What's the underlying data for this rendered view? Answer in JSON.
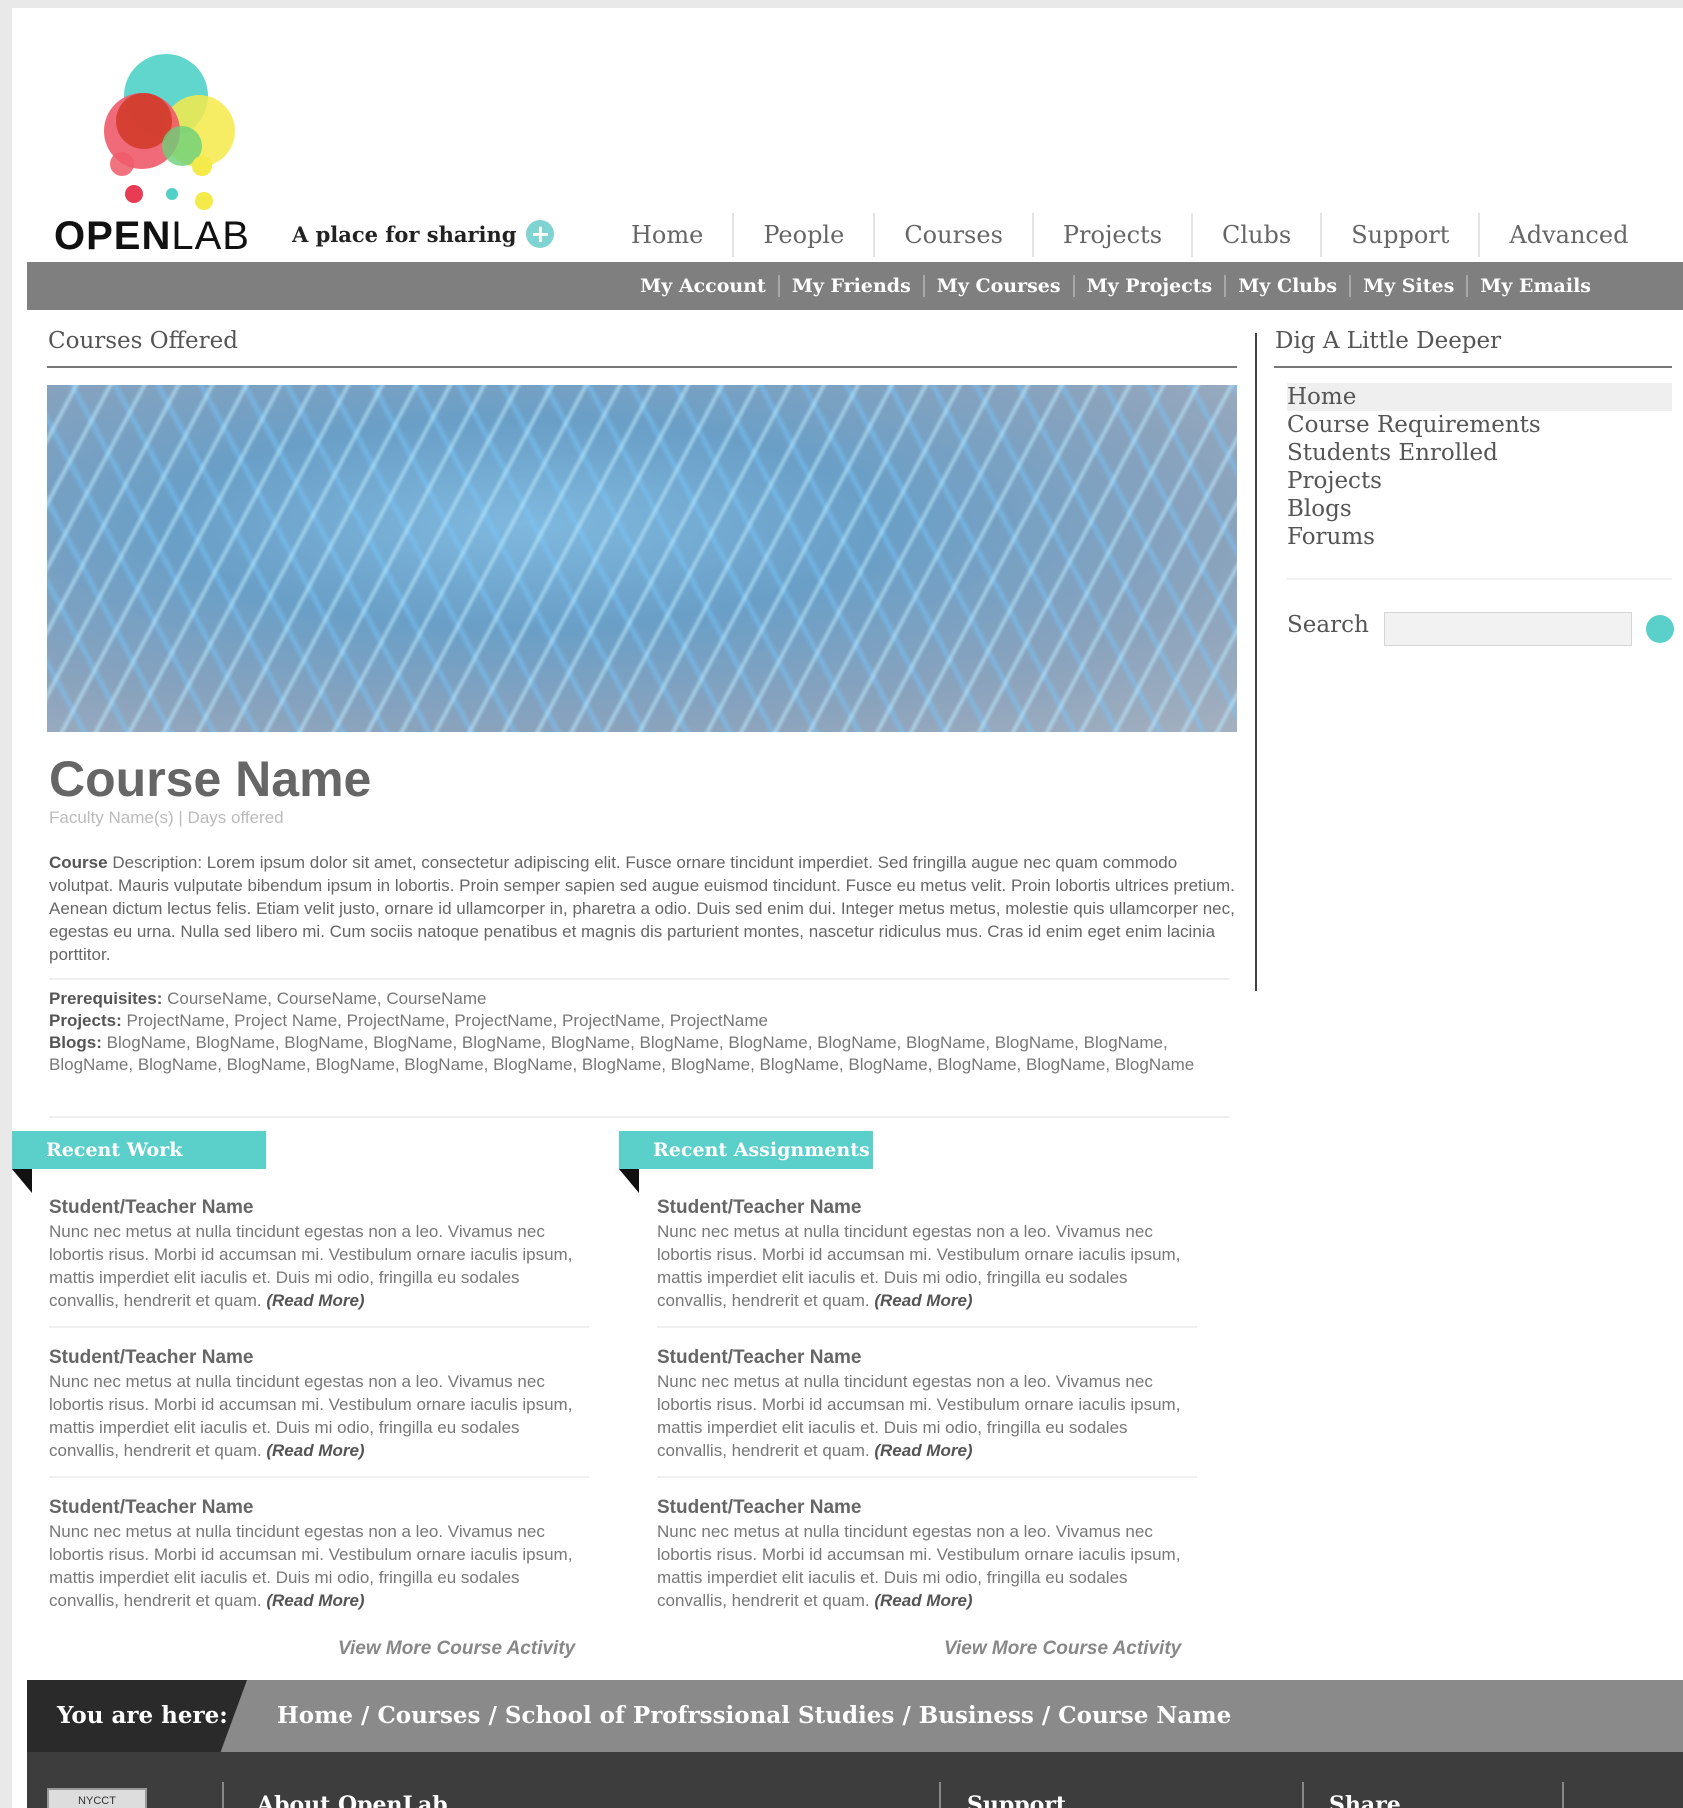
{
  "brand": {
    "logo_name": "OPENLAB",
    "logo_bold": "OPEN",
    "logo_light": "LAB",
    "tagline": "A place for sharing",
    "accent": "#5bd0ca"
  },
  "main_nav": [
    "Home",
    "People",
    "Courses",
    "Projects",
    "Clubs",
    "Support",
    "Advanced Search"
  ],
  "sub_nav": [
    "My Account",
    "My Friends",
    "My Courses",
    "My Projects",
    "My Clubs",
    "My Sites",
    "My Emails"
  ],
  "content": {
    "section_title": "Courses Offered",
    "course_name": "Course Name",
    "faculty_line": "Faculty Name(s) | Days offered",
    "description_label": "Course",
    "description": "Description: Lorem ipsum dolor sit amet, consectetur adipiscing elit. Fusce ornare tincidunt imperdiet. Sed fringilla augue nec quam commodo volutpat. Mauris vulputate bibendum ipsum in lobortis. Proin semper sapien sed augue euismod tincidunt. Fusce eu metus velit. Proin lobortis ultrices pretium. Aenean dictum lectus felis. Etiam velit justo, ornare id ullamcorper in, pharetra a odio. Duis sed enim dui. Integer metus metus, molestie quis ullamcorper nec, egestas eu urna. Nulla sed libero mi. Cum sociis natoque penatibus et magnis dis parturient montes, nascetur ridiculus mus. Cras id enim eget enim lacinia porttitor.",
    "prerequisites_label": "Prerequisites:",
    "prerequisites": "CourseName, CourseName, CourseName",
    "projects_label": "Projects:",
    "projects": "ProjectName, Project Name, ProjectName, ProjectName, ProjectName, ProjectName",
    "blogs_label": "Blogs:",
    "blogs": "BlogName, BlogName, BlogName, BlogName, BlogName, BlogName, BlogName, BlogName, BlogName, BlogName, BlogName, BlogName, BlogName, BlogName, BlogName, BlogName, BlogName, BlogName, BlogName, BlogName, BlogName, BlogName, BlogName, BlogName, BlogName"
  },
  "recent_work": {
    "title": "Recent Work",
    "entries": [
      {
        "name": "Student/Teacher Name",
        "text": "Nunc nec metus at nulla tincidunt egestas non a leo. Vivamus nec lobortis risus. Morbi id accumsan mi. Vestibulum ornare iaculis ipsum, mattis imperdiet elit iaculis et. Duis mi odio, fringilla eu sodales convallis, hendrerit et quam.",
        "read_more": "(Read More)"
      },
      {
        "name": "Student/Teacher Name",
        "text": "Nunc nec metus at nulla tincidunt egestas non a leo. Vivamus nec lobortis risus. Morbi id accumsan mi. Vestibulum ornare iaculis ipsum, mattis imperdiet elit iaculis et. Duis mi odio, fringilla eu sodales convallis, hendrerit et quam.",
        "read_more": "(Read More)"
      },
      {
        "name": "Student/Teacher Name",
        "text": "Nunc nec metus at nulla tincidunt egestas non a leo. Vivamus nec lobortis risus. Morbi id accumsan mi. Vestibulum ornare iaculis ipsum, mattis imperdiet elit iaculis et. Duis mi odio, fringilla eu sodales convallis, hendrerit et quam.",
        "read_more": "(Read More)"
      }
    ],
    "view_more": "View More Course Activity"
  },
  "recent_assignments": {
    "title": "Recent Assignments",
    "entries": [
      {
        "name": "Student/Teacher Name",
        "text": "Nunc nec metus at nulla tincidunt egestas non a leo. Vivamus nec lobortis risus. Morbi id accumsan mi. Vestibulum ornare iaculis ipsum, mattis imperdiet elit iaculis et. Duis mi odio, fringilla eu sodales convallis, hendrerit et quam.",
        "read_more": "(Read More)"
      },
      {
        "name": "Student/Teacher Name",
        "text": "Nunc nec metus at nulla tincidunt egestas non a leo. Vivamus nec lobortis risus. Morbi id accumsan mi. Vestibulum ornare iaculis ipsum, mattis imperdiet elit iaculis et. Duis mi odio, fringilla eu sodales convallis, hendrerit et quam.",
        "read_more": "(Read More)"
      },
      {
        "name": "Student/Teacher Name",
        "text": "Nunc nec metus at nulla tincidunt egestas non a leo. Vivamus nec lobortis risus. Morbi id accumsan mi. Vestibulum ornare iaculis ipsum, mattis imperdiet elit iaculis et. Duis mi odio, fringilla eu sodales convallis, hendrerit et quam.",
        "read_more": "(Read More)"
      }
    ],
    "view_more": "View More Course Activity"
  },
  "sidebar": {
    "title": "Dig A Little Deeper",
    "items": [
      "Home",
      "Course Requirements",
      "Students Enrolled",
      "Projects",
      "Blogs",
      "Forums"
    ],
    "search_label": "Search",
    "search_value": ""
  },
  "breadcrumb": {
    "label": "You are here:",
    "path": "Home / Courses / School of Profrssional Studies / Business / Course Name"
  },
  "footer": {
    "logo_text": "NYCCT",
    "about": "About OpenLab",
    "support": "Support",
    "share": "Share"
  }
}
